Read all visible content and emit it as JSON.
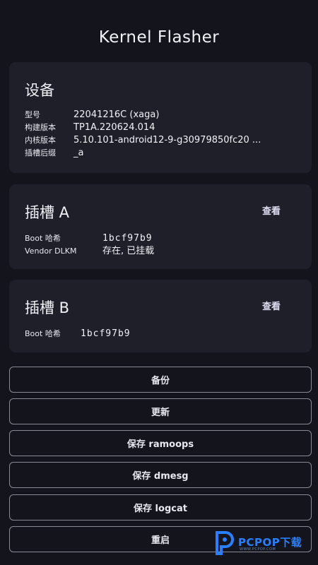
{
  "app": {
    "title": "Kernel Flasher"
  },
  "device": {
    "title": "设备",
    "rows": [
      {
        "label": "型号",
        "value": "22041216C (xaga)"
      },
      {
        "label": "构建版本",
        "value": "TP1A.220624.014"
      },
      {
        "label": "内核版本",
        "value": "5.10.101-android12-9-g30979850fc20 ..."
      },
      {
        "label": "插槽后缀",
        "value": "_a"
      }
    ]
  },
  "slot_a": {
    "title": "插槽 A",
    "view_label": "查看",
    "rows": [
      {
        "label": "Boot 哈希",
        "value": "1bcf97b9"
      },
      {
        "label": "Vendor DLKM",
        "value": "存在, 已挂载"
      }
    ]
  },
  "slot_b": {
    "title": "插槽 B",
    "view_label": "查看",
    "rows": [
      {
        "label": "Boot 哈希",
        "value": "1bcf97b9"
      }
    ]
  },
  "actions": [
    {
      "label": "备份"
    },
    {
      "label": "更新"
    },
    {
      "label": "保存 ramoops"
    },
    {
      "label": "保存 dmesg"
    },
    {
      "label": "保存 logcat"
    },
    {
      "label": "重启"
    }
  ],
  "watermark": {
    "text": "PCPOP下载",
    "sub": "WWW.PCPOP.COM",
    "color": "#2a7fff"
  }
}
